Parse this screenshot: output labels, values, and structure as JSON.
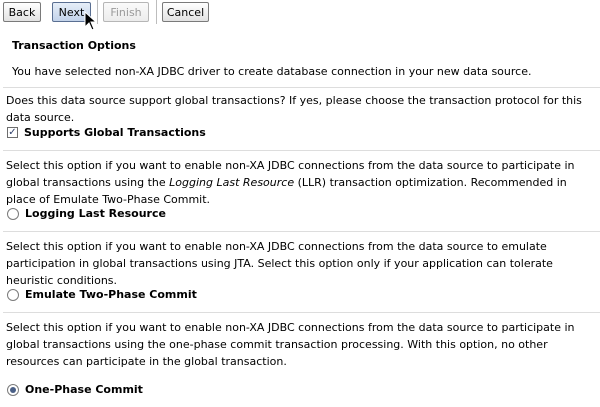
{
  "toolbar": {
    "back_label": "Back",
    "next_label": "Next",
    "finish_label": "Finish",
    "cancel_label": "Cancel"
  },
  "section": {
    "title": "Transaction Options",
    "info": "You have selected non-XA JDBC driver to create database connection in your new data source."
  },
  "question": "Does this data source support global transactions? If yes, please choose the transaction protocol for this data source.",
  "global_transactions": {
    "label": "Supports Global Transactions",
    "checked": true
  },
  "options": [
    {
      "description_pre": "Select this option if you want to enable non-XA JDBC connections from the data source to participate in global transactions using the ",
      "description_em": "Logging Last Resource",
      "description_post": " (LLR) transaction optimization. Recommended in place of Emulate Two-Phase Commit.",
      "label": "Logging Last Resource",
      "selected": false
    },
    {
      "description": "Select this option if you want to enable non-XA JDBC connections from the data source to emulate participation in global transactions using JTA. Select this option only if your application can tolerate heuristic conditions.",
      "label": "Emulate Two-Phase Commit",
      "selected": false
    },
    {
      "description": "Select this option if you want to enable non-XA JDBC connections from the data source to participate in global transactions using the one-phase commit transaction processing. With this option, no other resources can participate in the global transaction.",
      "label": "One-Phase Commit",
      "selected": true
    }
  ],
  "colors": {
    "accent": "#4a5f86",
    "primary_button": "#c3d3ea",
    "divider": "#dddddd"
  },
  "icons": {
    "checkbox_mark": "checkmark-icon",
    "cursor": "mouse-pointer-icon"
  }
}
